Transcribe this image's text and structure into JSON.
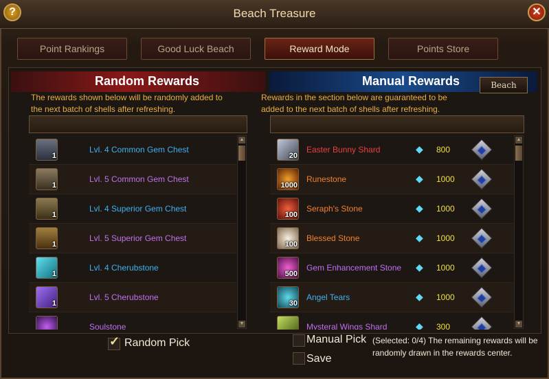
{
  "window": {
    "title": "Beach Treasure"
  },
  "tabs": [
    {
      "label": "Point Rankings"
    },
    {
      "label": "Good Luck Beach"
    },
    {
      "label": "Reward Mode"
    },
    {
      "label": "Points Store"
    }
  ],
  "random": {
    "title": "Random Rewards",
    "desc_line1": "The rewards shown below will be randomly added to",
    "desc_line2": "the next batch of shells after refreshing.",
    "items": [
      {
        "name": "Lvl. 4 Common Gem Chest",
        "qty": "1",
        "icon": "chest-icon",
        "color": "blue"
      },
      {
        "name": "Lvl. 5 Common Gem Chest",
        "qty": "1",
        "icon": "chest-icon",
        "color": "purple"
      },
      {
        "name": "Lvl. 4 Superior Gem Chest",
        "qty": "1",
        "icon": "chest-icon",
        "color": "blue"
      },
      {
        "name": "Lvl. 5 Superior Gem Chest",
        "qty": "1",
        "icon": "chest-icon",
        "color": "purple"
      },
      {
        "name": "Lvl. 4 Cherubstone",
        "qty": "1",
        "icon": "cherubstone-icon",
        "color": "blue"
      },
      {
        "name": "Lvl. 5 Cherubstone",
        "qty": "1",
        "icon": "cherubstone-icon",
        "color": "purple"
      },
      {
        "name": "Soulstone",
        "qty": "",
        "icon": "soulstone-icon",
        "color": "purple"
      }
    ],
    "checkbox_label": "Random Pick"
  },
  "manual": {
    "title": "Manual Rewards",
    "beach_button": "Beach",
    "desc_line1": "Rewards in the section below are guaranteed to be",
    "desc_line2": "added to the next batch of shells after refreshing.",
    "items": [
      {
        "name": "Easter Bunny Shard",
        "qty": "20",
        "price": "800",
        "color": "red"
      },
      {
        "name": "Runestone",
        "qty": "1000",
        "price": "1000",
        "color": "orange"
      },
      {
        "name": "Seraph's Stone",
        "qty": "100",
        "price": "1000",
        "color": "orange"
      },
      {
        "name": "Blessed Stone",
        "qty": "100",
        "price": "1000",
        "color": "orange"
      },
      {
        "name": "Gem Enhancement Stone",
        "qty": "500",
        "price": "1000",
        "color": "purple"
      },
      {
        "name": "Angel Tears",
        "qty": "30",
        "price": "1000",
        "color": "blue"
      },
      {
        "name": "Mysteral Wings Shard",
        "qty": "",
        "price": "300",
        "color": "purple"
      }
    ],
    "checkbox_label": "Manual Pick",
    "save_label": "Save",
    "note": "(Selected: 0/4) The remaining rewards will be randomly drawn in the rewards center."
  },
  "colors": {
    "gold": "#e8b040",
    "blue": "#40b0f0",
    "purple": "#c070f0",
    "red": "#e84040",
    "orange": "#f08030"
  }
}
